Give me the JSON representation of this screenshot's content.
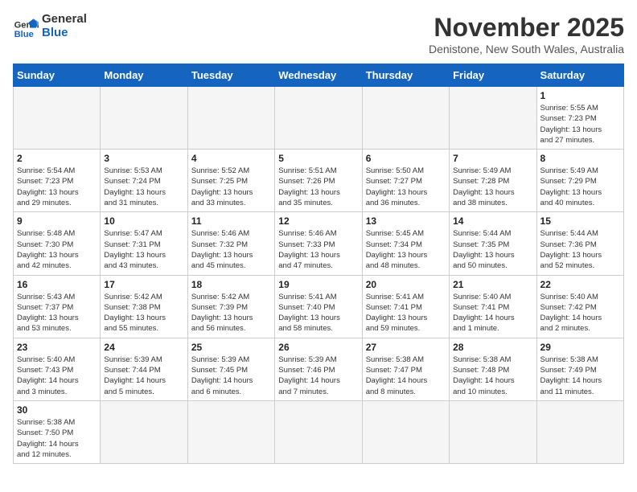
{
  "header": {
    "logo_general": "General",
    "logo_blue": "Blue",
    "month_title": "November 2025",
    "location": "Denistone, New South Wales, Australia"
  },
  "days_of_week": [
    "Sunday",
    "Monday",
    "Tuesday",
    "Wednesday",
    "Thursday",
    "Friday",
    "Saturday"
  ],
  "weeks": [
    [
      {
        "day": "",
        "info": ""
      },
      {
        "day": "",
        "info": ""
      },
      {
        "day": "",
        "info": ""
      },
      {
        "day": "",
        "info": ""
      },
      {
        "day": "",
        "info": ""
      },
      {
        "day": "",
        "info": ""
      },
      {
        "day": "1",
        "info": "Sunrise: 5:55 AM\nSunset: 7:23 PM\nDaylight: 13 hours\nand 27 minutes."
      }
    ],
    [
      {
        "day": "2",
        "info": "Sunrise: 5:54 AM\nSunset: 7:23 PM\nDaylight: 13 hours\nand 29 minutes."
      },
      {
        "day": "3",
        "info": "Sunrise: 5:53 AM\nSunset: 7:24 PM\nDaylight: 13 hours\nand 31 minutes."
      },
      {
        "day": "4",
        "info": "Sunrise: 5:52 AM\nSunset: 7:25 PM\nDaylight: 13 hours\nand 33 minutes."
      },
      {
        "day": "5",
        "info": "Sunrise: 5:51 AM\nSunset: 7:26 PM\nDaylight: 13 hours\nand 35 minutes."
      },
      {
        "day": "6",
        "info": "Sunrise: 5:50 AM\nSunset: 7:27 PM\nDaylight: 13 hours\nand 36 minutes."
      },
      {
        "day": "7",
        "info": "Sunrise: 5:49 AM\nSunset: 7:28 PM\nDaylight: 13 hours\nand 38 minutes."
      },
      {
        "day": "8",
        "info": "Sunrise: 5:49 AM\nSunset: 7:29 PM\nDaylight: 13 hours\nand 40 minutes."
      }
    ],
    [
      {
        "day": "9",
        "info": "Sunrise: 5:48 AM\nSunset: 7:30 PM\nDaylight: 13 hours\nand 42 minutes."
      },
      {
        "day": "10",
        "info": "Sunrise: 5:47 AM\nSunset: 7:31 PM\nDaylight: 13 hours\nand 43 minutes."
      },
      {
        "day": "11",
        "info": "Sunrise: 5:46 AM\nSunset: 7:32 PM\nDaylight: 13 hours\nand 45 minutes."
      },
      {
        "day": "12",
        "info": "Sunrise: 5:46 AM\nSunset: 7:33 PM\nDaylight: 13 hours\nand 47 minutes."
      },
      {
        "day": "13",
        "info": "Sunrise: 5:45 AM\nSunset: 7:34 PM\nDaylight: 13 hours\nand 48 minutes."
      },
      {
        "day": "14",
        "info": "Sunrise: 5:44 AM\nSunset: 7:35 PM\nDaylight: 13 hours\nand 50 minutes."
      },
      {
        "day": "15",
        "info": "Sunrise: 5:44 AM\nSunset: 7:36 PM\nDaylight: 13 hours\nand 52 minutes."
      }
    ],
    [
      {
        "day": "16",
        "info": "Sunrise: 5:43 AM\nSunset: 7:37 PM\nDaylight: 13 hours\nand 53 minutes."
      },
      {
        "day": "17",
        "info": "Sunrise: 5:42 AM\nSunset: 7:38 PM\nDaylight: 13 hours\nand 55 minutes."
      },
      {
        "day": "18",
        "info": "Sunrise: 5:42 AM\nSunset: 7:39 PM\nDaylight: 13 hours\nand 56 minutes."
      },
      {
        "day": "19",
        "info": "Sunrise: 5:41 AM\nSunset: 7:40 PM\nDaylight: 13 hours\nand 58 minutes."
      },
      {
        "day": "20",
        "info": "Sunrise: 5:41 AM\nSunset: 7:41 PM\nDaylight: 13 hours\nand 59 minutes."
      },
      {
        "day": "21",
        "info": "Sunrise: 5:40 AM\nSunset: 7:41 PM\nDaylight: 14 hours\nand 1 minute."
      },
      {
        "day": "22",
        "info": "Sunrise: 5:40 AM\nSunset: 7:42 PM\nDaylight: 14 hours\nand 2 minutes."
      }
    ],
    [
      {
        "day": "23",
        "info": "Sunrise: 5:40 AM\nSunset: 7:43 PM\nDaylight: 14 hours\nand 3 minutes."
      },
      {
        "day": "24",
        "info": "Sunrise: 5:39 AM\nSunset: 7:44 PM\nDaylight: 14 hours\nand 5 minutes."
      },
      {
        "day": "25",
        "info": "Sunrise: 5:39 AM\nSunset: 7:45 PM\nDaylight: 14 hours\nand 6 minutes."
      },
      {
        "day": "26",
        "info": "Sunrise: 5:39 AM\nSunset: 7:46 PM\nDaylight: 14 hours\nand 7 minutes."
      },
      {
        "day": "27",
        "info": "Sunrise: 5:38 AM\nSunset: 7:47 PM\nDaylight: 14 hours\nand 8 minutes."
      },
      {
        "day": "28",
        "info": "Sunrise: 5:38 AM\nSunset: 7:48 PM\nDaylight: 14 hours\nand 10 minutes."
      },
      {
        "day": "29",
        "info": "Sunrise: 5:38 AM\nSunset: 7:49 PM\nDaylight: 14 hours\nand 11 minutes."
      }
    ],
    [
      {
        "day": "30",
        "info": "Sunrise: 5:38 AM\nSunset: 7:50 PM\nDaylight: 14 hours\nand 12 minutes."
      },
      {
        "day": "",
        "info": ""
      },
      {
        "day": "",
        "info": ""
      },
      {
        "day": "",
        "info": ""
      },
      {
        "day": "",
        "info": ""
      },
      {
        "day": "",
        "info": ""
      },
      {
        "day": "",
        "info": ""
      }
    ]
  ]
}
